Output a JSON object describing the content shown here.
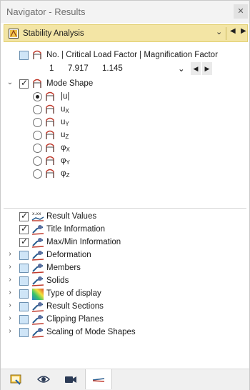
{
  "window": {
    "title": "Navigator - Results",
    "close_glyph": "✕"
  },
  "combo": {
    "label": "Stability Analysis",
    "dropdown_glyph": "⌄",
    "prev_glyph": "◀",
    "next_glyph": "▶"
  },
  "table": {
    "header": "No. | Critical Load Factor | Magnification Factor",
    "row": {
      "no": "1",
      "critical_load_factor": "7.917",
      "magnification_factor": "1.145"
    },
    "dropdown_glyph": "⌄"
  },
  "mode_shape": {
    "label": "Mode Shape",
    "options": [
      {
        "main": "|u|",
        "sub": "",
        "selected": true
      },
      {
        "main": "u",
        "sub": "X",
        "selected": false
      },
      {
        "main": "u",
        "sub": "Y",
        "selected": false
      },
      {
        "main": "u",
        "sub": "Z",
        "selected": false
      },
      {
        "main": "φ",
        "sub": "X",
        "selected": false
      },
      {
        "main": "φ",
        "sub": "Y",
        "selected": false
      },
      {
        "main": "φ",
        "sub": "Z",
        "selected": false
      }
    ]
  },
  "settings": [
    {
      "label": "Result Values",
      "checked": true,
      "expandable": false,
      "icon": "result-values-icon"
    },
    {
      "label": "Title Information",
      "checked": true,
      "expandable": false,
      "icon": "title-info-icon"
    },
    {
      "label": "Max/Min Information",
      "checked": true,
      "expandable": false,
      "icon": "maxmin-info-icon"
    },
    {
      "label": "Deformation",
      "checked": false,
      "expandable": true,
      "icon": "deformation-icon"
    },
    {
      "label": "Members",
      "checked": false,
      "expandable": true,
      "icon": "members-icon"
    },
    {
      "label": "Solids",
      "checked": false,
      "expandable": true,
      "icon": "solids-icon"
    },
    {
      "label": "Type of display",
      "checked": false,
      "expandable": true,
      "icon": "type-of-display-icon"
    },
    {
      "label": "Result Sections",
      "checked": false,
      "expandable": true,
      "icon": "result-sections-icon"
    },
    {
      "label": "Clipping Planes",
      "checked": false,
      "expandable": true,
      "icon": "clipping-planes-icon"
    },
    {
      "label": "Scaling of Mode Shapes",
      "checked": false,
      "expandable": true,
      "icon": "scaling-icon"
    }
  ],
  "tabs": [
    {
      "name": "data-tab",
      "icon": "data-navigator-icon",
      "active": false
    },
    {
      "name": "display-tab",
      "icon": "eye-icon",
      "active": false
    },
    {
      "name": "views-tab",
      "icon": "camera-icon",
      "active": false
    },
    {
      "name": "results-tab",
      "icon": "results-icon",
      "active": true
    }
  ],
  "colors": {
    "combo_bg": "#f3e5a5",
    "checkbox_blue": "#cfe5f7",
    "accent_red": "#c0392b",
    "accent_blue": "#2a5d8f"
  }
}
